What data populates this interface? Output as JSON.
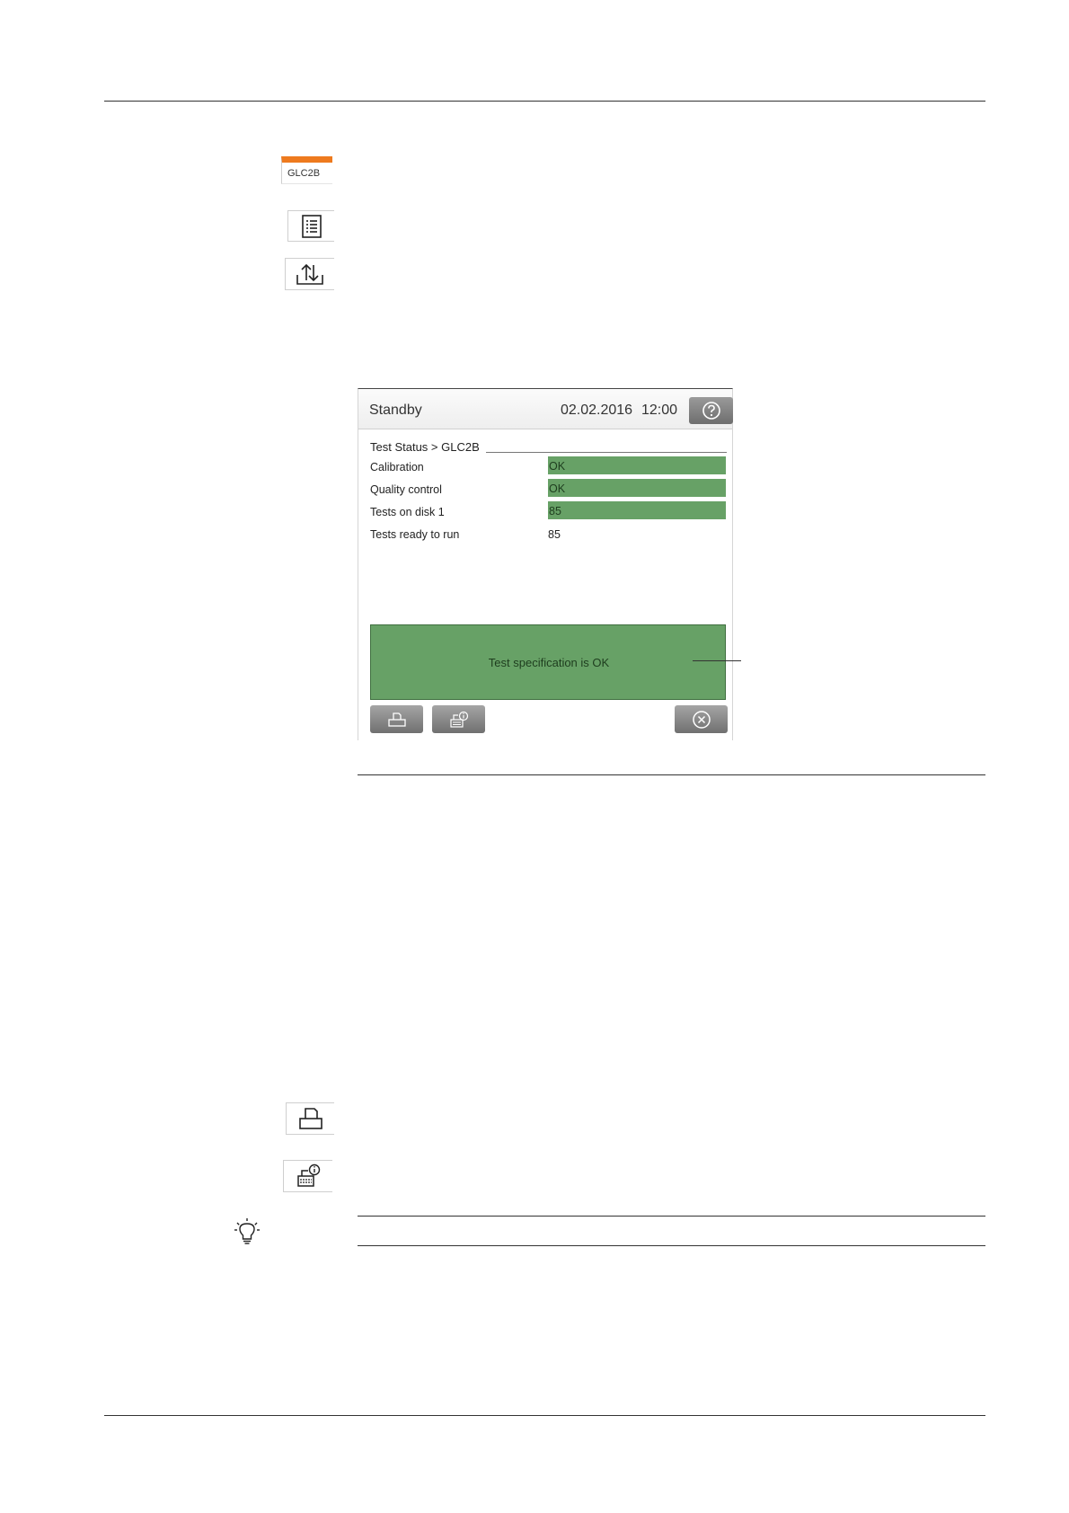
{
  "side_icons": {
    "glc_tab_label": "GLC2B"
  },
  "screen": {
    "header": {
      "status": "Standby",
      "date": "02.02.2016",
      "time": "12:00"
    },
    "breadcrumb": "Test Status > GLC2B",
    "rows": [
      {
        "label": "Calibration",
        "value": "OK",
        "highlight": true
      },
      {
        "label": "Quality control",
        "value": "OK",
        "highlight": true
      },
      {
        "label": "Tests on disk 1",
        "value": "85",
        "highlight": true
      },
      {
        "label": "Tests ready to run",
        "value": "85",
        "highlight": false
      }
    ],
    "message": "Test specification is OK"
  },
  "colors": {
    "accent_orange": "#ee7a1e",
    "status_green": "#67a166",
    "button_gray": "#8a8a8a"
  },
  "icons": {
    "list": "list-icon",
    "transfer": "upload-download-icon",
    "help": "help-icon",
    "print": "print-icon",
    "printer_info": "printer-info-icon",
    "close": "close-icon",
    "tip": "lightbulb-icon"
  }
}
